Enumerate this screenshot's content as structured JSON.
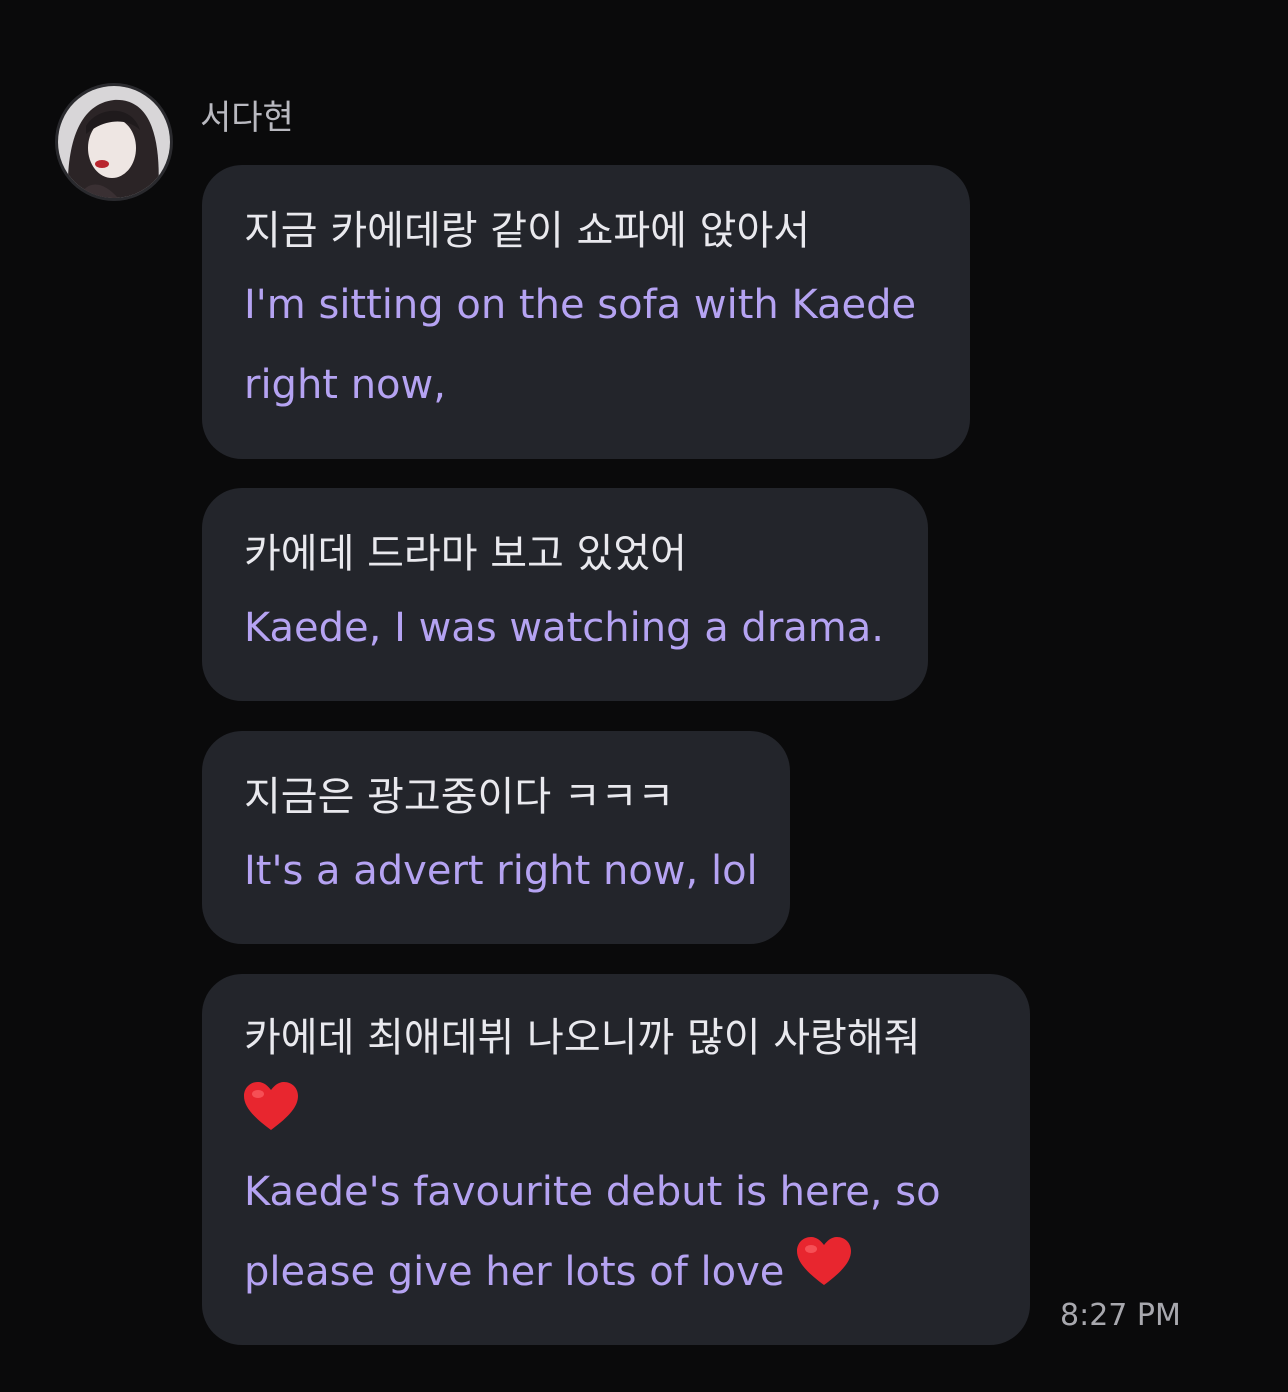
{
  "sender": {
    "name": "서다현"
  },
  "messages": [
    {
      "korean": [
        "지금 카에데랑 같이 쇼파에 앉아서"
      ],
      "english": [
        "I'm sitting on the sofa with Kaede",
        "right now,"
      ]
    },
    {
      "korean": [
        "카에데 드라마 보고 있었어"
      ],
      "english": [
        "Kaede, I was watching a drama."
      ]
    },
    {
      "korean": [
        "지금은 광고중이다 ㅋㅋㅋ"
      ],
      "english": [
        "It's a advert right now, lol"
      ]
    },
    {
      "korean": [
        "카에데 최애데뷔 나오니까 많이 사랑해줘"
      ],
      "english": [
        "Kaede's favourite debut is here, so",
        "please give her lots of love"
      ]
    }
  ],
  "timestamp": "8:27 PM",
  "icons": [
    "heart-emoji-icon"
  ],
  "colors": {
    "background": "#0a0a0b",
    "bubble": "#23252b",
    "korean_text": "#e9e9ee",
    "translation_text": "#b5a3f2",
    "heart": "#e8262f"
  }
}
